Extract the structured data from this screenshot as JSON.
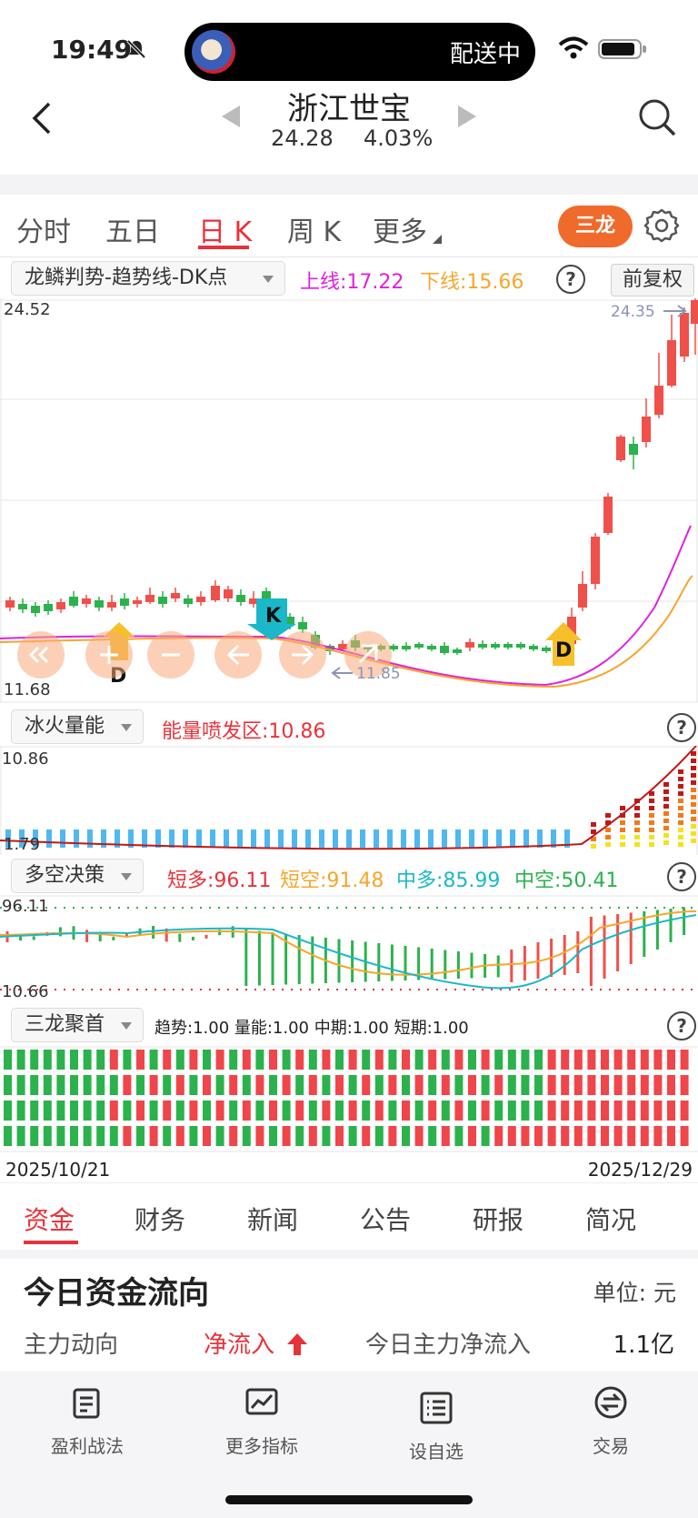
{
  "status": {
    "time": "19:49",
    "island_text": "配送中"
  },
  "header": {
    "title": "浙江世宝",
    "price": "24.28",
    "change_pct": "4.03%"
  },
  "period_tabs": [
    "分时",
    "五日",
    "日 K",
    "周 K",
    "更多"
  ],
  "active_tab": "日 K",
  "sanlong_button": "三龙",
  "main_indicator": {
    "selector": "龙鳞判势-趋势线-DK点",
    "upper_label": "上线:17.22",
    "lower_label": "下线:15.66",
    "restore_button": "前复权",
    "y_max": "24.52",
    "y_min": "11.68",
    "high_marker": "24.35",
    "low_marker": "11.85",
    "k_marker": "K",
    "d_marker": "D",
    "colors": {
      "up": "#f0504a",
      "down": "#2bb24c",
      "upper_line": "#e020e0",
      "lower_line": "#f7a62b"
    }
  },
  "energy": {
    "selector": "冰火量能",
    "label": "能量喷发区:10.86",
    "y_max": "10.86",
    "y_min": "1.79"
  },
  "duokong": {
    "selector": "多空决策",
    "short_long": "短多:96.11",
    "short_short": "短空:91.48",
    "mid_long": "中多:85.99",
    "mid_short": "中空:50.41",
    "y_max": "96.11",
    "y_min": "10.66"
  },
  "sanlong": {
    "selector": "三龙聚首",
    "values": "趋势:1.00 量能:1.00 中期:1.00 短期:1.00"
  },
  "dates": {
    "start": "2025/10/21",
    "end": "2025/12/29"
  },
  "sub_tabs": [
    "资金",
    "财务",
    "新闻",
    "公告",
    "研报",
    "简况"
  ],
  "fund_flow": {
    "title": "今日资金流向",
    "unit": "单位: 元",
    "main_label": "主力动向",
    "direction": "净流入",
    "today_label": "今日主力净流入",
    "today_value": "1.1亿"
  },
  "bottom_bar": [
    "盈利战法",
    "更多指标",
    "设自选",
    "交易"
  ]
}
